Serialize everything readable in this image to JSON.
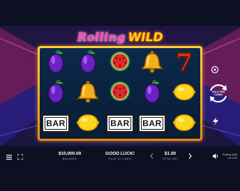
{
  "game": {
    "logo_part1": "Rolling",
    "logo_part2": "WILD",
    "game_name": "Rolling Wild",
    "game_version": "v.0.0.00"
  },
  "reels": [
    [
      "plum",
      "plum",
      "bar"
    ],
    [
      "plum",
      "bell",
      "lemon"
    ],
    [
      "watermelon",
      "watermelon",
      "bar"
    ],
    [
      "bell",
      "plum",
      "bar"
    ],
    [
      "seven",
      "lemon",
      "lemon"
    ]
  ],
  "bar_label": "BAR",
  "seven_label": "7",
  "hud": {
    "balance_value": "$10,000.00",
    "balance_label": "BALANCE",
    "message": "GOOD LUCK!",
    "message_sub": "PLAY 10 LINES",
    "bet_value": "$1.00",
    "bet_label": "TOTAL BET"
  },
  "controls": {
    "hold_line1": "HOLD FOR",
    "hold_line2": "TURBO"
  },
  "colors": {
    "frame": "#ffcf3a",
    "reel_bg": "#0c2a4a",
    "plum": "#7a2bd0",
    "bell": "#e8a515",
    "lemon": "#ffd81a",
    "watermelon": "#e2252b",
    "seven": "#e4321c"
  }
}
